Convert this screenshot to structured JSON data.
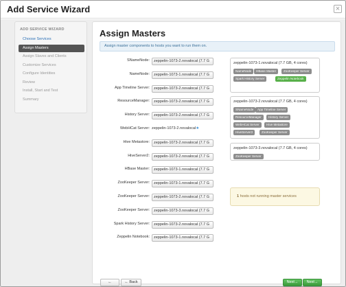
{
  "window": {
    "title": "Add Service Wizard",
    "close_label": "×"
  },
  "sidebar": {
    "title": "ADD SERVICE WIZARD",
    "items": [
      {
        "label": "Choose Services",
        "state": "link"
      },
      {
        "label": "Assign Masters",
        "state": "active"
      },
      {
        "label": "Assign Slaves and Clients",
        "state": "disabled"
      },
      {
        "label": "Customize Services",
        "state": "disabled"
      },
      {
        "label": "Configure Identities",
        "state": "disabled"
      },
      {
        "label": "Review",
        "state": "disabled"
      },
      {
        "label": "Install, Start and Test",
        "state": "disabled"
      },
      {
        "label": "Summary",
        "state": "disabled"
      }
    ]
  },
  "main": {
    "title": "Assign Masters",
    "info": "Assign master components to hosts you want to run them on.",
    "assignments": [
      {
        "label": "SNameNode:",
        "host": "zeppelin-1073-2.novalocal (7.7 G"
      },
      {
        "label": "NameNode:",
        "host": "zeppelin-1073-1.novalocal (7.7 G"
      },
      {
        "label": "App Timeline Server:",
        "host": "zeppelin-1073-2.novalocal (7.7 G"
      },
      {
        "label": "ResourceManager:",
        "host": "zeppelin-1073-2.novalocal (7.7 G"
      },
      {
        "label": "History Server:",
        "host": "zeppelin-1073-2.novalocal (7.7 G"
      },
      {
        "label": "WebHCat Server:",
        "host": "zeppelin-1073-2.novalocal",
        "static": true,
        "suffix": "★"
      },
      {
        "label": "Hive Metastore:",
        "host": "zeppelin-1073-2.novalocal (7.7 G"
      },
      {
        "label": "HiveServer2:",
        "host": "zeppelin-1073-2.novalocal (7.7 G"
      },
      {
        "label": "HBase Master:",
        "host": "zeppelin-1073-1.novalocal (7.7 G"
      },
      {
        "label": "ZooKeeper Server:",
        "host": "zeppelin-1073-1.novalocal (7.7 G"
      },
      {
        "label": "ZooKeeper Server:",
        "host": "zeppelin-1073-2.novalocal (7.7 G"
      },
      {
        "label": "ZooKeeper Server:",
        "host": "zeppelin-1073-3.novalocal (7.7 G"
      },
      {
        "label": "Spark History Server:",
        "host": "zeppelin-1073-2.novalocal (7.7 G"
      },
      {
        "label": "Zeppelin Notebook:",
        "host": "zeppelin-1073-1.novalocal (7.7 G"
      }
    ],
    "hosts": [
      {
        "title": "zeppelin-1073-1.novalocal (7.7 GB, 4 cores)",
        "badges": [
          {
            "label": "NameNode"
          },
          {
            "label": "HBase Master"
          },
          {
            "label": "ZooKeeper Server"
          },
          {
            "label": "Spark History Server"
          },
          {
            "label": "Zeppelin Notebook",
            "new": true
          }
        ]
      },
      {
        "title": "zeppelin-1073-2.novalocal (7.7 GB, 4 cores)",
        "badges": [
          {
            "label": "SNameNode"
          },
          {
            "label": "App Timeline Server"
          },
          {
            "label": "ResourceManager"
          },
          {
            "label": "History Server"
          },
          {
            "label": "WebHCat Server"
          },
          {
            "label": "Hive Metastore"
          },
          {
            "label": "HiveServer2"
          },
          {
            "label": "ZooKeeper Server"
          }
        ]
      },
      {
        "title": "zeppelin-1073-3.novalocal (7.7 GB, 4 cores)",
        "badges": [
          {
            "label": "ZooKeeper Server"
          }
        ]
      }
    ],
    "warning_count": "1",
    "warning_text": " hosts not running master services",
    "back_label_1": "← Back",
    "back_label_2": "← Back",
    "next_label_1": "Next→",
    "next_label_2": "Next→"
  },
  "colors": {
    "active_sidebar": "#545454",
    "next_button": "#4aa84a",
    "new_badge": "#58b04a",
    "info_bg": "#e8f1f8",
    "warn_bg": "#fcf8e3"
  }
}
